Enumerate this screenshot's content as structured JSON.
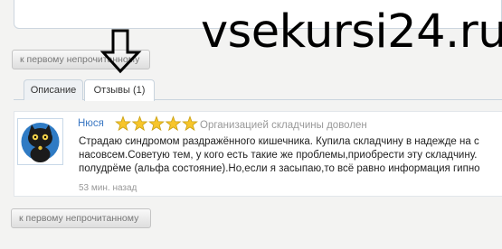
{
  "watermark": "vsekursi24.ru",
  "unread_button_label": "к первому непрочитанному",
  "tabs": [
    {
      "label": "Описание"
    },
    {
      "label": "Отзывы (1)"
    }
  ],
  "review": {
    "author": "Нюся",
    "rating": 5,
    "rating_max": 5,
    "rating_text": "Организацией складчины доволен",
    "text_lines": [
      "Страдаю синдромом раздражённого кишечника. Купила складчину в надежде на с",
      "насовсем.Советую тем, у кого есть такие же проблемы,приобрести эту складчину. ",
      "полудрёме (альфа состояние).Но,если я засыпаю,то всё равно информация гипно"
    ],
    "time_ago": "53 мин. назад"
  }
}
